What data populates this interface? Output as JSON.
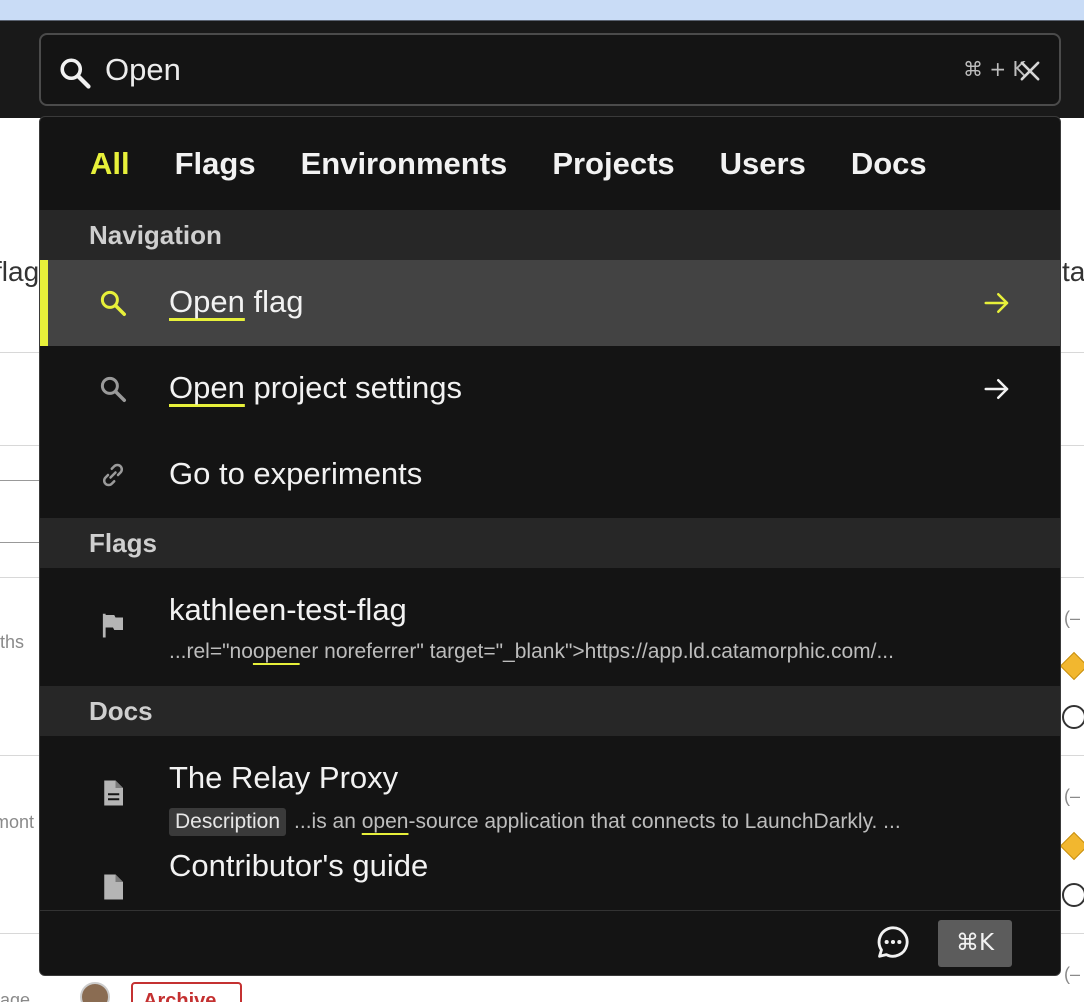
{
  "search": {
    "value": "Open",
    "shortcut_hint": "⌘ + K"
  },
  "tabs": [
    {
      "label": "All",
      "active": true
    },
    {
      "label": "Flags"
    },
    {
      "label": "Environments"
    },
    {
      "label": "Projects"
    },
    {
      "label": "Users"
    },
    {
      "label": "Docs"
    }
  ],
  "sections": {
    "navigation": {
      "heading": "Navigation",
      "items": [
        {
          "match": "Open",
          "rest": " flag",
          "icon": "search-icon",
          "active": true
        },
        {
          "match": "Open",
          "rest": " project settings",
          "icon": "search-icon"
        },
        {
          "title": "Go to experiments",
          "icon": "link-icon"
        }
      ]
    },
    "flags": {
      "heading": "Flags",
      "items": [
        {
          "title": "kathleen-test-flag",
          "snippet_pre": "...rel=\"no",
          "snippet_match": "open",
          "snippet_post": "er noreferrer\" target=\"_blank\">https://app.ld.catamorphic.com/...",
          "icon": "flag-icon"
        }
      ]
    },
    "docs": {
      "heading": "Docs",
      "items": [
        {
          "title": "The Relay Proxy",
          "badge": "Description",
          "snippet_pre": "...is an ",
          "snippet_match": "open",
          "snippet_post": "-source application that connects to LaunchDarkly. ...",
          "icon": "document-icon"
        },
        {
          "title": "Contributor's guide",
          "icon": "document-icon"
        }
      ]
    }
  },
  "footer": {
    "shortcut": "⌘K"
  },
  "background": {
    "left_fragments": [
      "flag",
      "ths",
      "mont",
      "age"
    ],
    "right_fragments": [
      "ta",
      "(–",
      "(–",
      "(–"
    ],
    "archive_label": "Archive"
  },
  "colors": {
    "accent": "#e7f03a",
    "panel": "#141414",
    "section": "#272727",
    "active_row": "#434343"
  }
}
